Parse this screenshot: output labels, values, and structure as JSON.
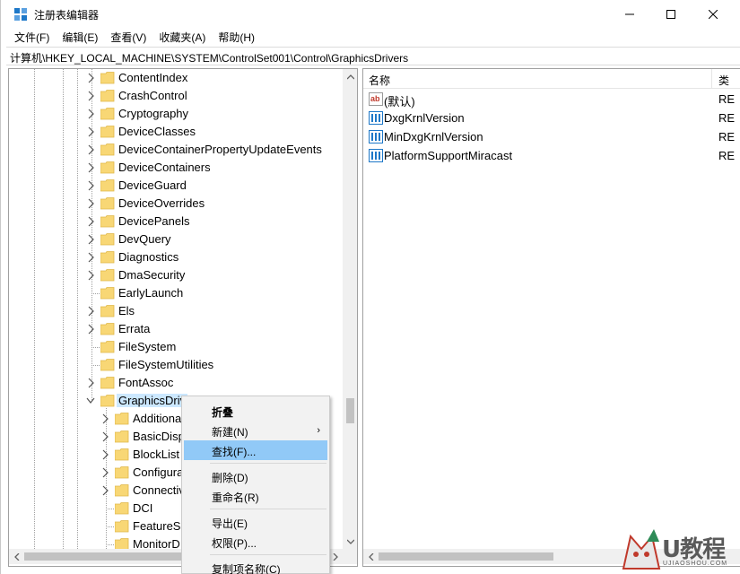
{
  "window": {
    "title": "注册表编辑器",
    "minimize_label": "—",
    "maximize_label": "□",
    "close_label": "✕"
  },
  "menubar": [
    {
      "label": "文件(F)"
    },
    {
      "label": "编辑(E)"
    },
    {
      "label": "查看(V)"
    },
    {
      "label": "收藏夹(A)"
    },
    {
      "label": "帮助(H)"
    }
  ],
  "address": {
    "path": "计算机\\HKEY_LOCAL_MACHINE\\SYSTEM\\ControlSet001\\Control\\GraphicsDrivers"
  },
  "tree": {
    "items": [
      {
        "label": "ContentIndex",
        "expander": "collapsed",
        "level": 1
      },
      {
        "label": "CrashControl",
        "expander": "collapsed",
        "level": 1
      },
      {
        "label": "Cryptography",
        "expander": "collapsed",
        "level": 1
      },
      {
        "label": "DeviceClasses",
        "expander": "collapsed",
        "level": 1
      },
      {
        "label": "DeviceContainerPropertyUpdateEvents",
        "expander": "collapsed",
        "level": 1
      },
      {
        "label": "DeviceContainers",
        "expander": "collapsed",
        "level": 1
      },
      {
        "label": "DeviceGuard",
        "expander": "collapsed",
        "level": 1
      },
      {
        "label": "DeviceOverrides",
        "expander": "collapsed",
        "level": 1
      },
      {
        "label": "DevicePanels",
        "expander": "collapsed",
        "level": 1
      },
      {
        "label": "DevQuery",
        "expander": "collapsed",
        "level": 1
      },
      {
        "label": "Diagnostics",
        "expander": "collapsed",
        "level": 1
      },
      {
        "label": "DmaSecurity",
        "expander": "collapsed",
        "level": 1
      },
      {
        "label": "EarlyLaunch",
        "expander": "none",
        "level": 1
      },
      {
        "label": "Els",
        "expander": "collapsed",
        "level": 1
      },
      {
        "label": "Errata",
        "expander": "collapsed",
        "level": 1
      },
      {
        "label": "FileSystem",
        "expander": "none",
        "level": 1
      },
      {
        "label": "FileSystemUtilities",
        "expander": "none",
        "level": 1
      },
      {
        "label": "FontAssoc",
        "expander": "collapsed",
        "level": 1
      },
      {
        "label": "GraphicsDriv",
        "expander": "expanded",
        "level": 1,
        "selected": true
      },
      {
        "label": "Additiona",
        "expander": "collapsed",
        "level": 2
      },
      {
        "label": "BasicDisp",
        "expander": "collapsed",
        "level": 2
      },
      {
        "label": "BlockList",
        "expander": "collapsed",
        "level": 2
      },
      {
        "label": "Configura",
        "expander": "collapsed",
        "level": 2
      },
      {
        "label": "Connectiv",
        "expander": "collapsed",
        "level": 2
      },
      {
        "label": "DCI",
        "expander": "none",
        "level": 2
      },
      {
        "label": "FeatureSe",
        "expander": "none",
        "level": 2
      },
      {
        "label": "MonitorD",
        "expander": "none",
        "level": 2
      }
    ]
  },
  "values": {
    "col_name": "名称",
    "col_type": "类",
    "rows": [
      {
        "name": "(默认)",
        "icon": "string-value-icon",
        "type": "RE"
      },
      {
        "name": "DxgKrnlVersion",
        "icon": "binary-value-icon",
        "type": "RE"
      },
      {
        "name": "MinDxgKrnlVersion",
        "icon": "binary-value-icon",
        "type": "RE"
      },
      {
        "name": "PlatformSupportMiracast",
        "icon": "binary-value-icon",
        "type": "RE"
      }
    ]
  },
  "context_menu": {
    "collapse": "折叠",
    "new": "新建(N)",
    "find": "查找(F)...",
    "delete": "删除(D)",
    "rename": "重命名(R)",
    "export": "导出(E)",
    "permissions": "权限(P)...",
    "copy_key_name": "复制项名称(C)"
  },
  "watermark": {
    "text": "U教程",
    "url": "UJIAOSHOU.COM"
  },
  "colors": {
    "folder": "#f8d775",
    "selection": "#cce8ff",
    "menu_hover": "#91c9f7",
    "registry_icon": "#1e78c8"
  }
}
